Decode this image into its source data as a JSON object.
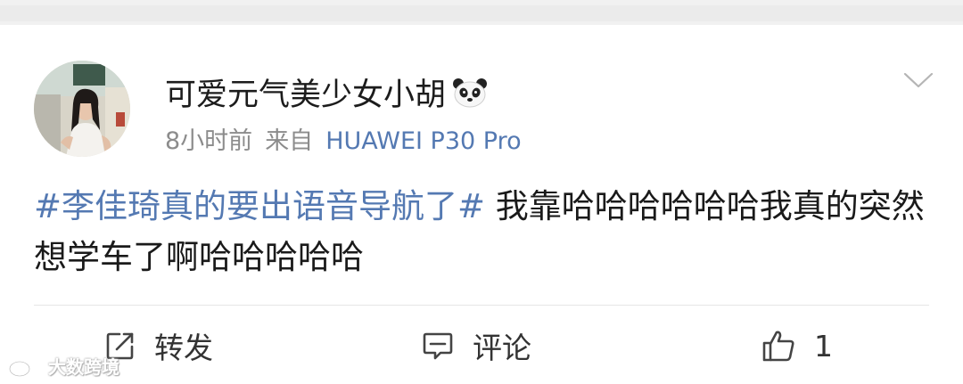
{
  "post": {
    "username": "可爱元气美少女小胡",
    "username_emoji": "panda-emoji",
    "time": "8小时前",
    "from_label": "来自",
    "device": "HUAWEI P30 Pro",
    "content": {
      "topic": "#李佳琦真的要出语音导航了#",
      "text": " 我靠哈哈哈哈哈哈我真的突然想学车了啊哈哈哈哈哈"
    }
  },
  "actions": {
    "repost_label": "转发",
    "comment_label": "评论",
    "like_count": "1"
  },
  "watermark": "大数跨境",
  "icons": {
    "menu": "chevron-down-icon",
    "repost": "repost-icon",
    "comment": "comment-icon",
    "like": "thumbs-up-icon",
    "watermark": "weibo-logo-icon"
  },
  "colors": {
    "link_blue": "#5479b2",
    "meta_gray": "#8c8c8c",
    "text": "#1a1a1a"
  }
}
